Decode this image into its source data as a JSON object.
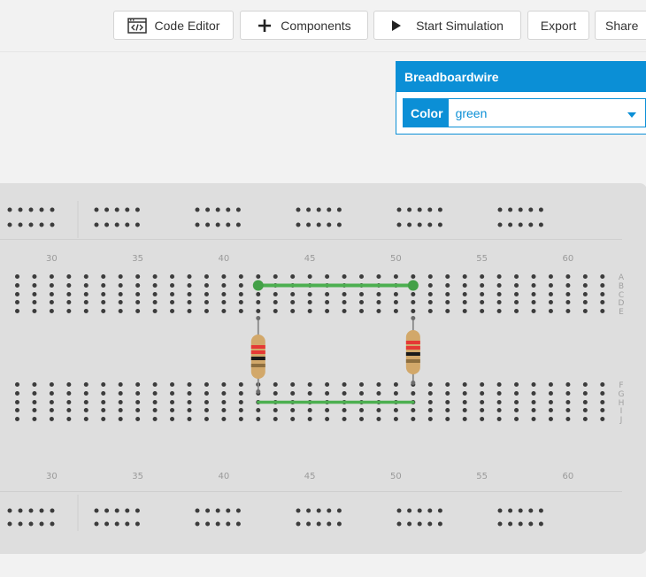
{
  "toolbar": {
    "code_editor": "Code Editor",
    "components": "Components",
    "start_simulation": "Start Simulation",
    "export": "Export",
    "share": "Share"
  },
  "panel": {
    "title": "Breadboardwire",
    "color_label": "Color",
    "color_value": "green"
  },
  "breadboard": {
    "columns_first": 28,
    "columns_last": 62,
    "column_labels": [
      "30",
      "35",
      "40",
      "45",
      "50",
      "55",
      "60"
    ],
    "row_labels_top": [
      "A",
      "B",
      "C",
      "D",
      "E"
    ],
    "row_labels_bottom": [
      "F",
      "G",
      "H",
      "I",
      "J"
    ],
    "wires": [
      {
        "color": "green",
        "row": "B",
        "from_column": 42,
        "to_column": 51
      },
      {
        "color": "green",
        "row": "H",
        "from_column": 42,
        "to_column": 51
      }
    ],
    "resistors": [
      {
        "column": 42,
        "from_row": "E",
        "to_row": "G"
      },
      {
        "column": 51,
        "from_row": "E",
        "to_row": "F"
      }
    ]
  },
  "colors": {
    "accent": "#0b8fd6",
    "wire_green": "#4caf50",
    "board": "#dedede"
  },
  "icons": [
    "code-editor-icon",
    "plus-icon",
    "play-icon",
    "chevron-down-icon"
  ]
}
